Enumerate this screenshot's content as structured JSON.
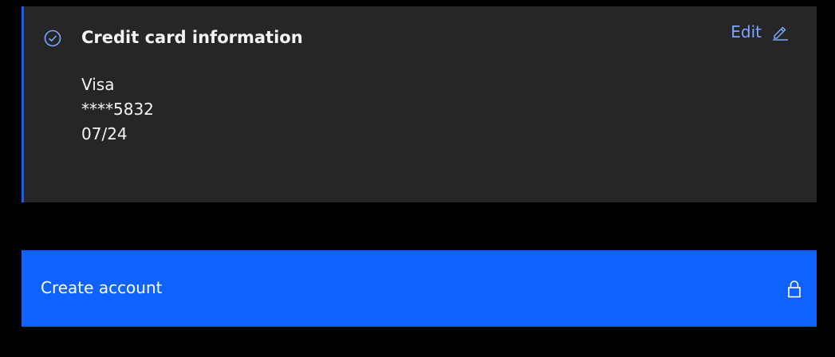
{
  "card": {
    "title": "Credit card information",
    "edit_label": "Edit",
    "lines": [
      "Visa",
      "****5832",
      "07/24"
    ]
  },
  "button": {
    "label": "Create account"
  },
  "icons": {
    "completed": "checkmark-circle-icon",
    "edit": "pencil-icon",
    "lock": "lock-icon"
  },
  "colors": {
    "page_background": "#000000",
    "card_background": "#262626",
    "accent": "#0f62fe",
    "link": "#78a9ff",
    "text": "#f4f4f4"
  }
}
